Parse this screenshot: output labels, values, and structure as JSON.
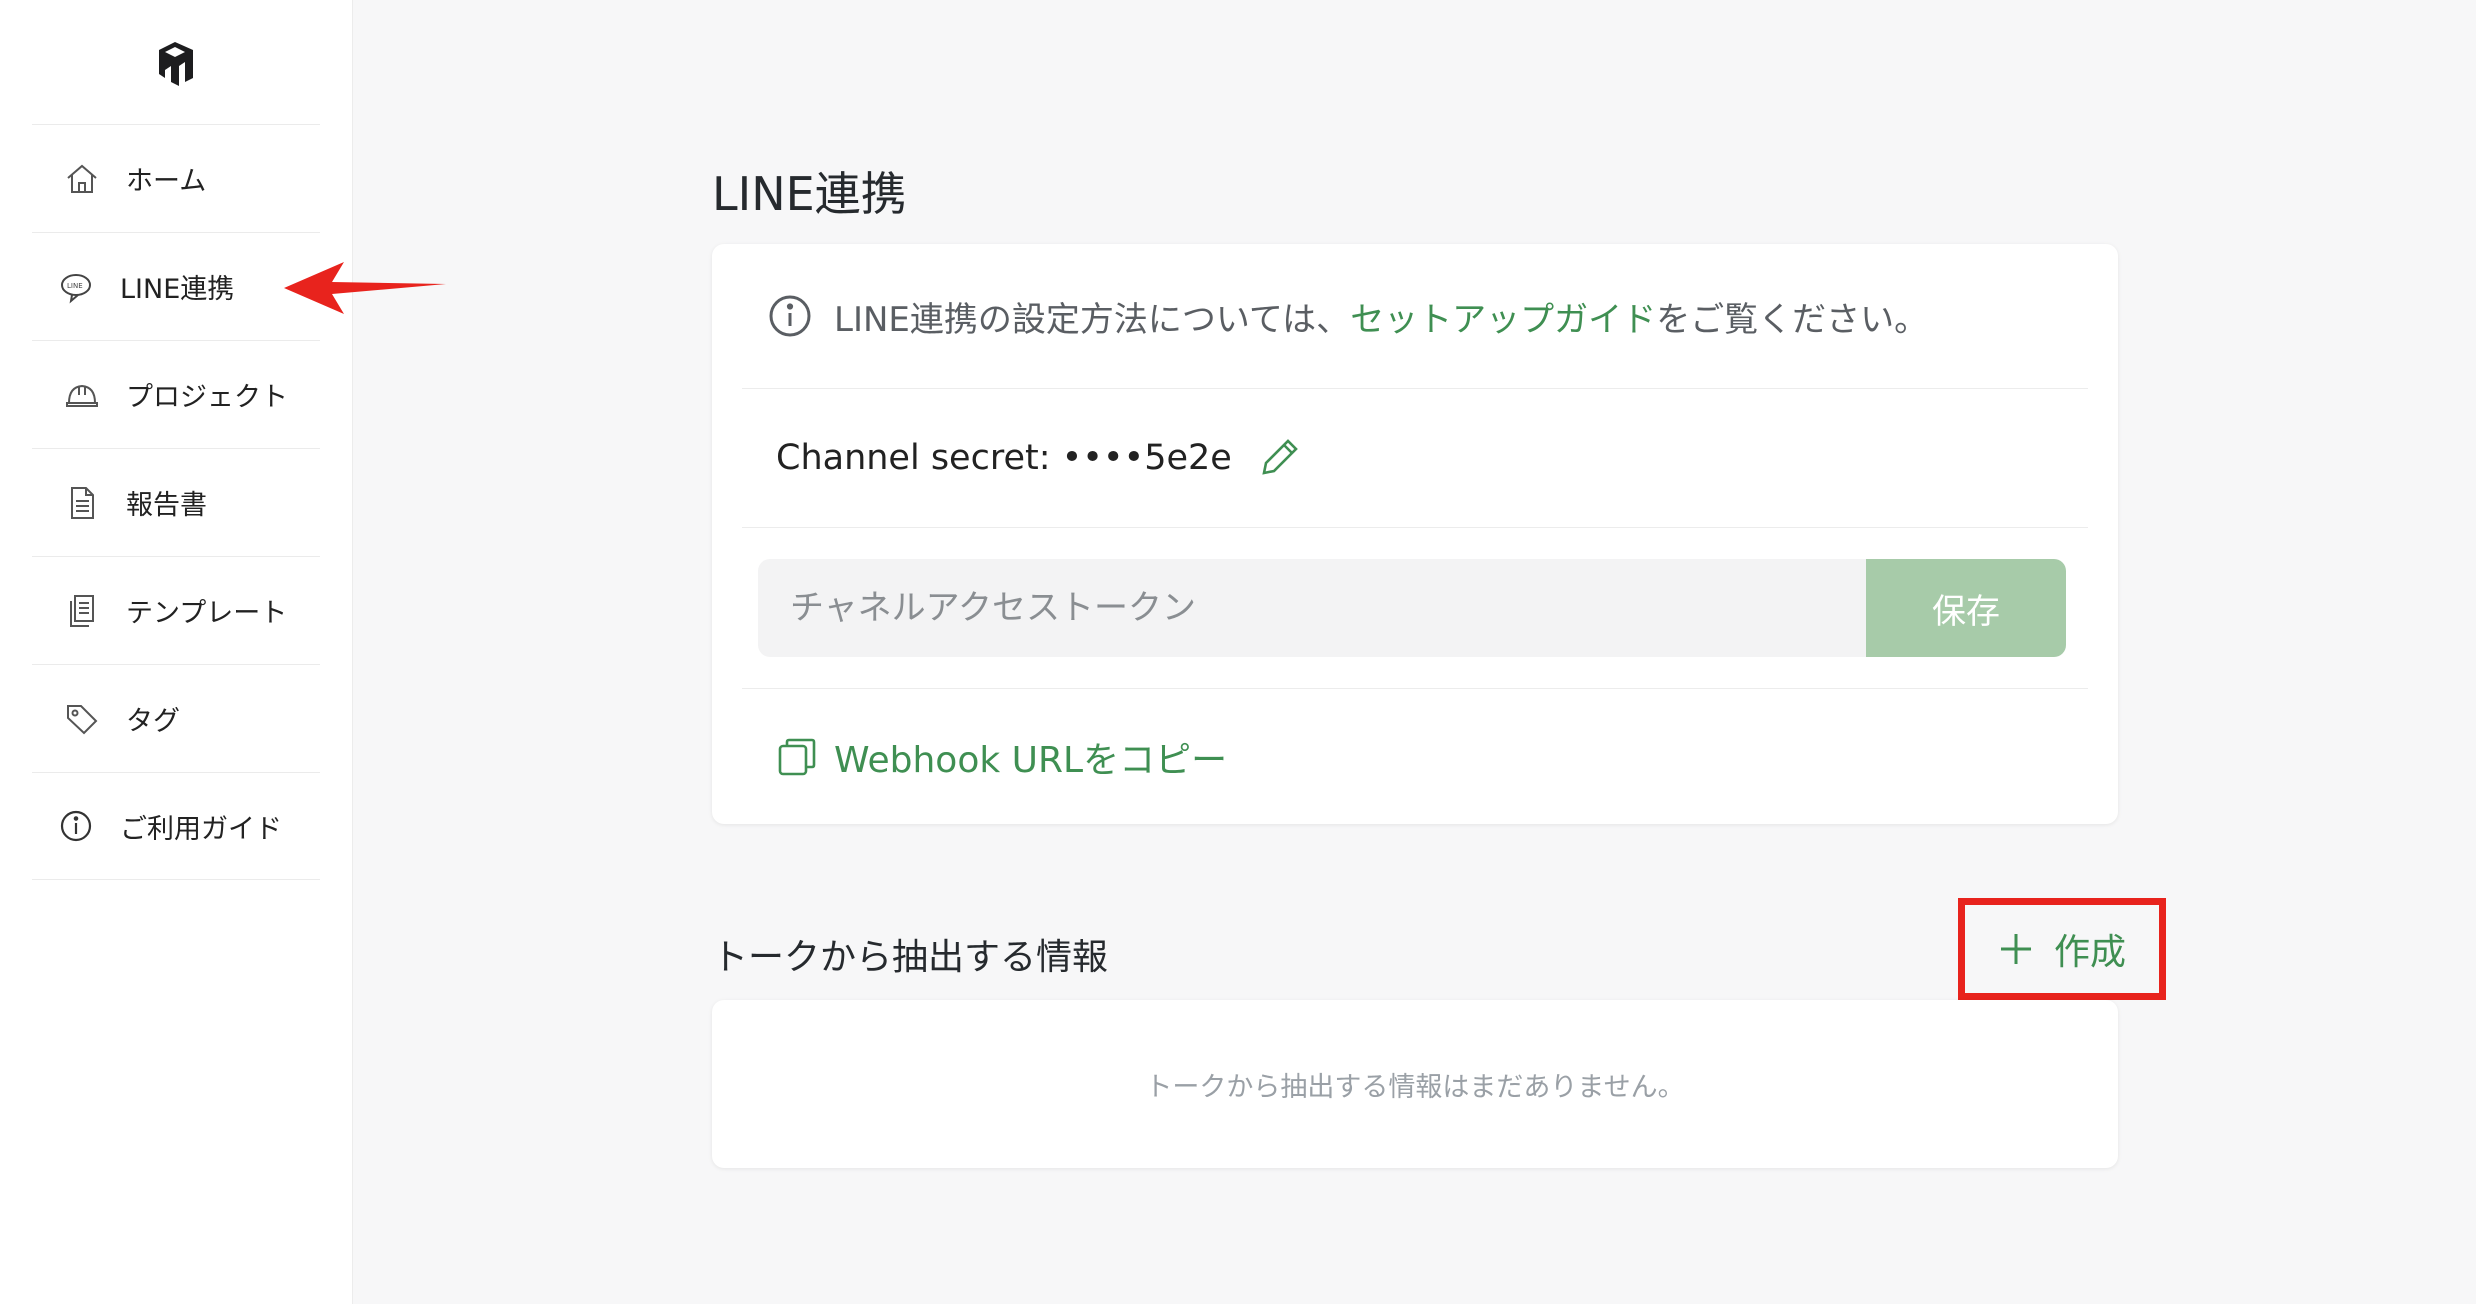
{
  "sidebar": {
    "items": [
      {
        "label": "ホーム",
        "icon": "home-icon"
      },
      {
        "label": "LINE連携",
        "icon": "line-icon"
      },
      {
        "label": "プロジェクト",
        "icon": "helmet-icon"
      },
      {
        "label": "報告書",
        "icon": "document-icon"
      },
      {
        "label": "テンプレート",
        "icon": "template-icon"
      },
      {
        "label": "タグ",
        "icon": "tag-icon"
      },
      {
        "label": "ご利用ガイド",
        "icon": "info-icon"
      }
    ]
  },
  "page": {
    "title": "LINE連携"
  },
  "info": {
    "prefix": "LINE連携の設定方法については、",
    "link": "セットアップガイド",
    "suffix": "をご覧ください。"
  },
  "secret": {
    "label": "Channel secret: ••••5e2e"
  },
  "token": {
    "placeholder": "チャネルアクセストークン",
    "save_label": "保存"
  },
  "webhook": {
    "label": "Webhook URLをコピー"
  },
  "extract": {
    "title": "トークから抽出する情報",
    "create_label": "作成",
    "empty_text": "トークから抽出する情報はまだありません。"
  },
  "colors": {
    "accent_green": "#3f8f52",
    "save_button": "#a7cba9",
    "highlight_red": "#e8231d"
  }
}
